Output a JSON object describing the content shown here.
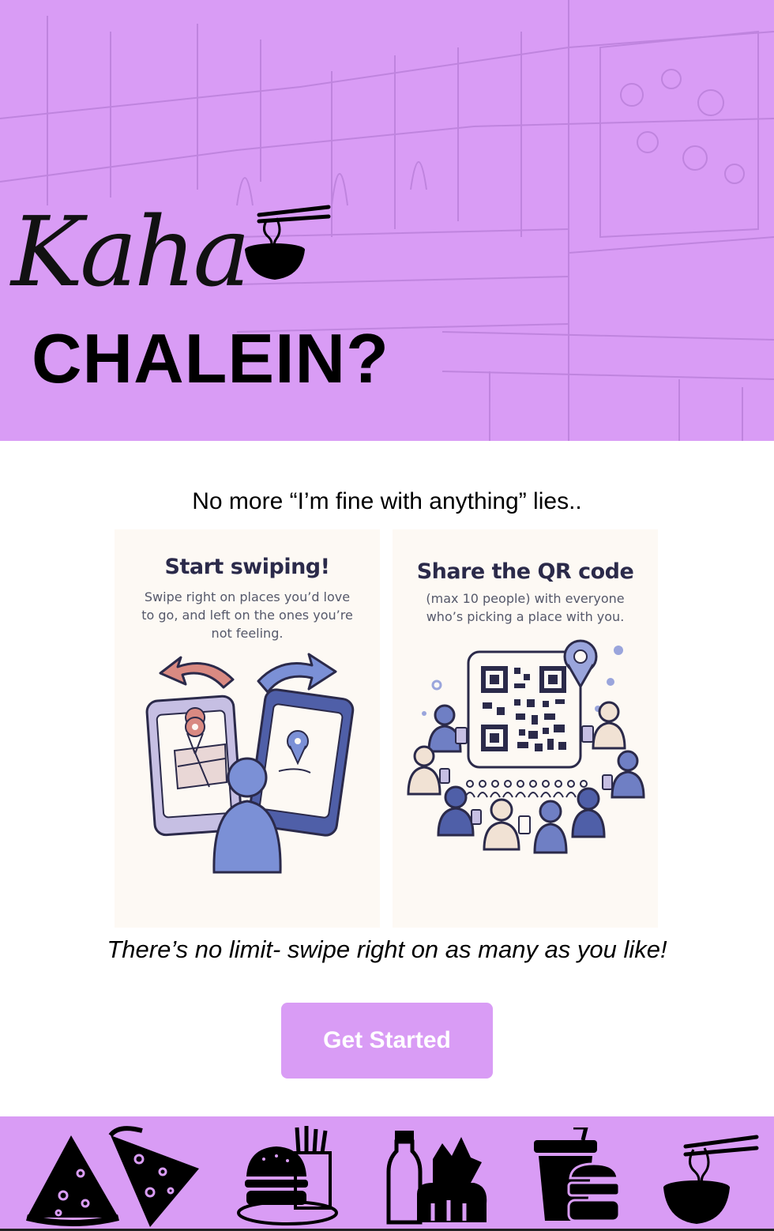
{
  "brand": {
    "script": "Kaha",
    "main": "CHALEIN?"
  },
  "tagline": "No more “I’m fine with anything” lies..",
  "cards": [
    {
      "title": "Start swiping!",
      "desc": "Swipe right on places you’d love to go, and left on the ones you’re not feeling."
    },
    {
      "title": "Share the QR code",
      "desc": "(max 10 people) with everyone who’s picking a place with you."
    }
  ],
  "note": "There’s no limit- swipe right on as many as you like!",
  "cta": {
    "label": "Get Started"
  },
  "colors": {
    "accent": "#d99cf5",
    "ink": "#2b2a4a",
    "card_bg": "#fdf9f4",
    "blue": "#6f7fc4",
    "coral": "#d98a82"
  },
  "footer_icons": [
    "pizza-icon",
    "burger-fries-icon",
    "groceries-icon",
    "drink-burger-icon",
    "noodle-bowl-icon"
  ]
}
